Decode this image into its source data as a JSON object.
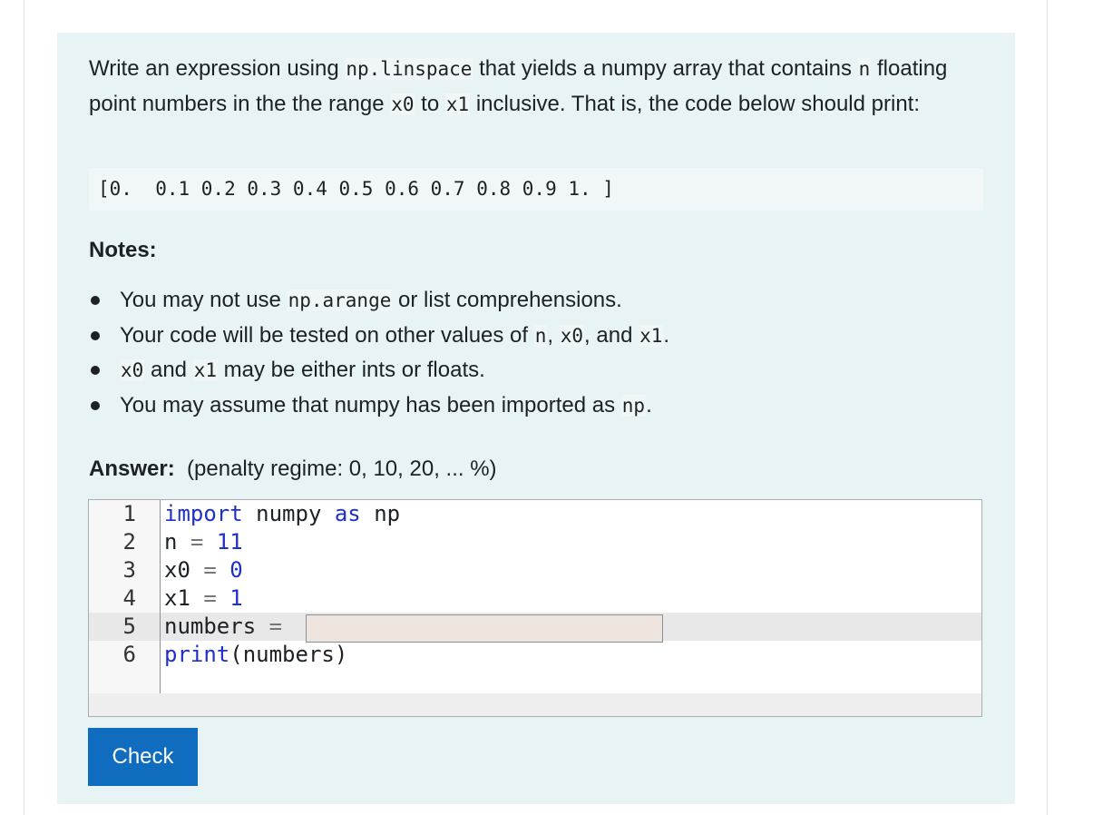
{
  "question": {
    "intro_1": "Write an expression using ",
    "intro_code_1": "np.linspace",
    "intro_2": " that yields a numpy array that contains ",
    "intro_code_2": "n",
    "intro_3": " floating point numbers in the the range ",
    "intro_code_3": "x0",
    "intro_4": " to ",
    "intro_code_4": "x1",
    "intro_5": " inclusive. That is, the code below should print:",
    "expected_output": "[0.  0.1 0.2 0.3 0.4 0.5 0.6 0.7 0.8 0.9 1. ]",
    "notes_heading": "Notes:",
    "notes": {
      "n1_a": "You may not use ",
      "n1_code": "np.arange",
      "n1_b": " or list comprehensions.",
      "n2_a": "Your code will be tested on other values of ",
      "n2_code1": "n",
      "n2_b": ", ",
      "n2_code2": "x0",
      "n2_c": ", and ",
      "n2_code3": "x1",
      "n2_d": ".",
      "n3_code1": "x0",
      "n3_a": " and ",
      "n3_code2": "x1",
      "n3_b": " may be either ints or floats.",
      "n4_a": "You may assume that numpy has been imported as ",
      "n4_code": "np",
      "n4_b": "."
    }
  },
  "answer": {
    "label": "Answer:",
    "penalty": "(penalty regime: 0, 10, 20, ... %)"
  },
  "editor": {
    "line_numbers": [
      "1",
      "2",
      "3",
      "4",
      "5",
      "6"
    ],
    "l1_kw1": "import",
    "l1_mid": " numpy ",
    "l1_kw2": "as",
    "l1_end": " np",
    "l2_var": "n ",
    "l2_op": "=",
    "l2_num": " 11",
    "l3_var": "x0 ",
    "l3_op": "=",
    "l3_num": " 0",
    "l4_var": "x1 ",
    "l4_op": "=",
    "l4_num": " 1",
    "l5_var": "numbers ",
    "l5_op": "=",
    "gap_value": "",
    "l6_fn": "print",
    "l6_rest": "(numbers)"
  },
  "check_button": "Check",
  "colors": {
    "panel_bg": "#e7f3f5",
    "button_bg": "#0f6cbf",
    "keyword": "#1f30c9",
    "gap_bg": "#eee4de"
  }
}
